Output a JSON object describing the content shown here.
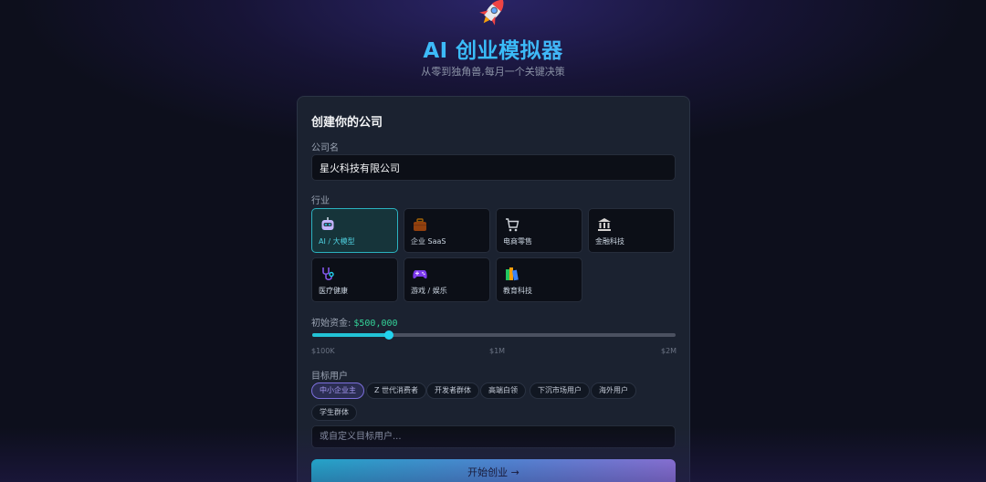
{
  "hero": {
    "icon": "rocket-icon",
    "title": "AI 创业模拟器",
    "subtitle": "从零到独角兽,每月一个关键决策"
  },
  "form": {
    "title": "创建你的公司",
    "company_name_label": "公司名",
    "company_name_value": "星火科技有限公司",
    "industry_label": "行业",
    "industries": [
      {
        "label": "AI / 大模型",
        "icon": "robot-icon",
        "selected": true
      },
      {
        "label": "企业 SaaS",
        "icon": "briefcase-icon",
        "selected": false
      },
      {
        "label": "电商零售",
        "icon": "shopping-cart-icon",
        "selected": false
      },
      {
        "label": "金融科技",
        "icon": "bank-icon",
        "selected": false
      },
      {
        "label": "医疗健康",
        "icon": "stethoscope-icon",
        "selected": false
      },
      {
        "label": "游戏 / 娱乐",
        "icon": "gamepad-icon",
        "selected": false
      },
      {
        "label": "教育科技",
        "icon": "books-icon",
        "selected": false
      }
    ],
    "budget_label": "初始资金:",
    "budget_value": "$500,000",
    "budget_fraction": 0.21,
    "budget_ticks": [
      "$100K",
      "$1M",
      "$2M"
    ],
    "target_label": "目标用户",
    "targets": [
      {
        "label": "中小企业主",
        "selected": true
      },
      {
        "label": "Z 世代消费者",
        "selected": false
      },
      {
        "label": "开发者群体",
        "selected": false
      },
      {
        "label": "高端白领",
        "selected": false
      },
      {
        "label": "下沉市场用户",
        "selected": false
      },
      {
        "label": "海外用户",
        "selected": false
      },
      {
        "label": "学生群体",
        "selected": false
      }
    ],
    "custom_target_placeholder": "或自定义目标用户...",
    "start_button_label": "开始创业 →"
  },
  "colors": {
    "accent_cyan": "#22d3ee",
    "accent_purple": "#a78bfa",
    "budget_green": "#34d399",
    "card_bg": "#1b2230"
  }
}
